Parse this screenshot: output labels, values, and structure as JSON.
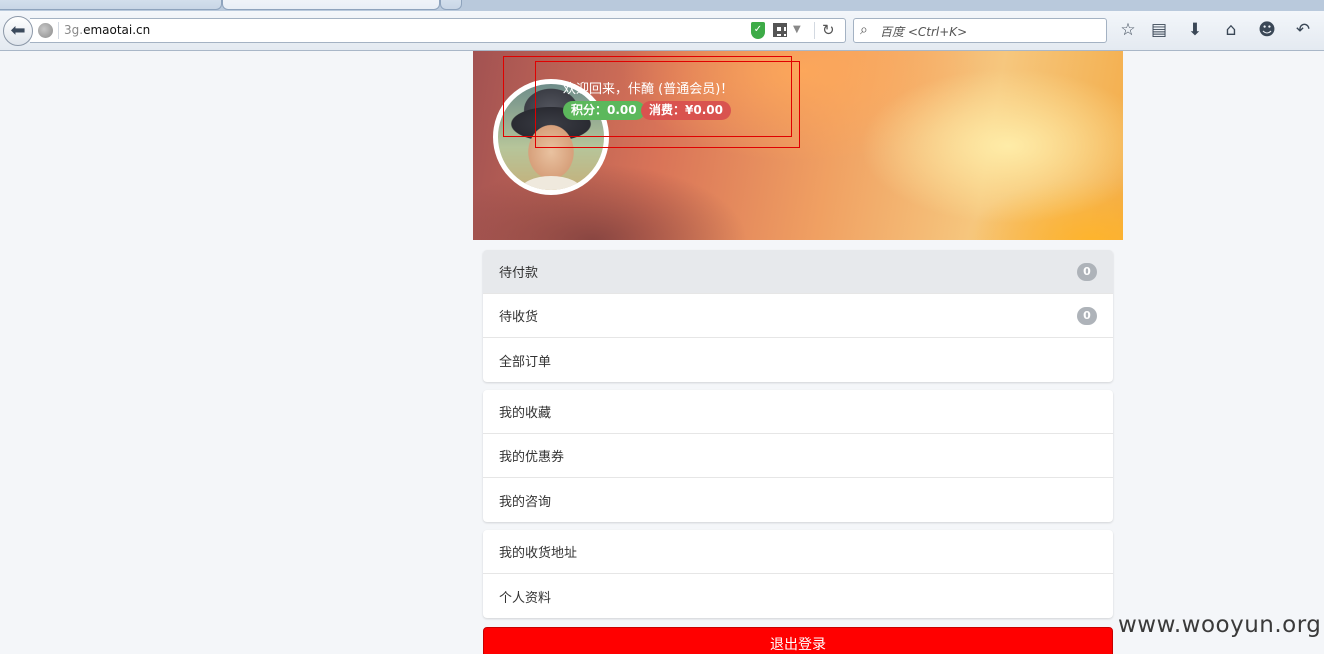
{
  "browser": {
    "url_prefix": "3g.",
    "url_host": "emaotai.cn",
    "search_placeholder": "百度 <Ctrl+K>",
    "accent_shield": "#3dab47"
  },
  "profile": {
    "welcome_text": "欢迎回来，佧醃 (普通会员)！",
    "points_label": "积分：0.00",
    "spend_label": "消费：¥0.00",
    "points_color": "#5cb85c",
    "spend_color": "#d9534f"
  },
  "orders": [
    {
      "label": "待付款",
      "count": "0"
    },
    {
      "label": "待收货",
      "count": "0"
    },
    {
      "label": "全部订单"
    }
  ],
  "favorites": [
    {
      "label": "我的收藏"
    },
    {
      "label": "我的优惠券"
    },
    {
      "label": "我的咨询"
    }
  ],
  "account": [
    {
      "label": "我的收货地址"
    },
    {
      "label": "个人资料"
    }
  ],
  "logout_label": "退出登录",
  "logout_color": "#ff0000",
  "watermark": "www.wooyun.org"
}
